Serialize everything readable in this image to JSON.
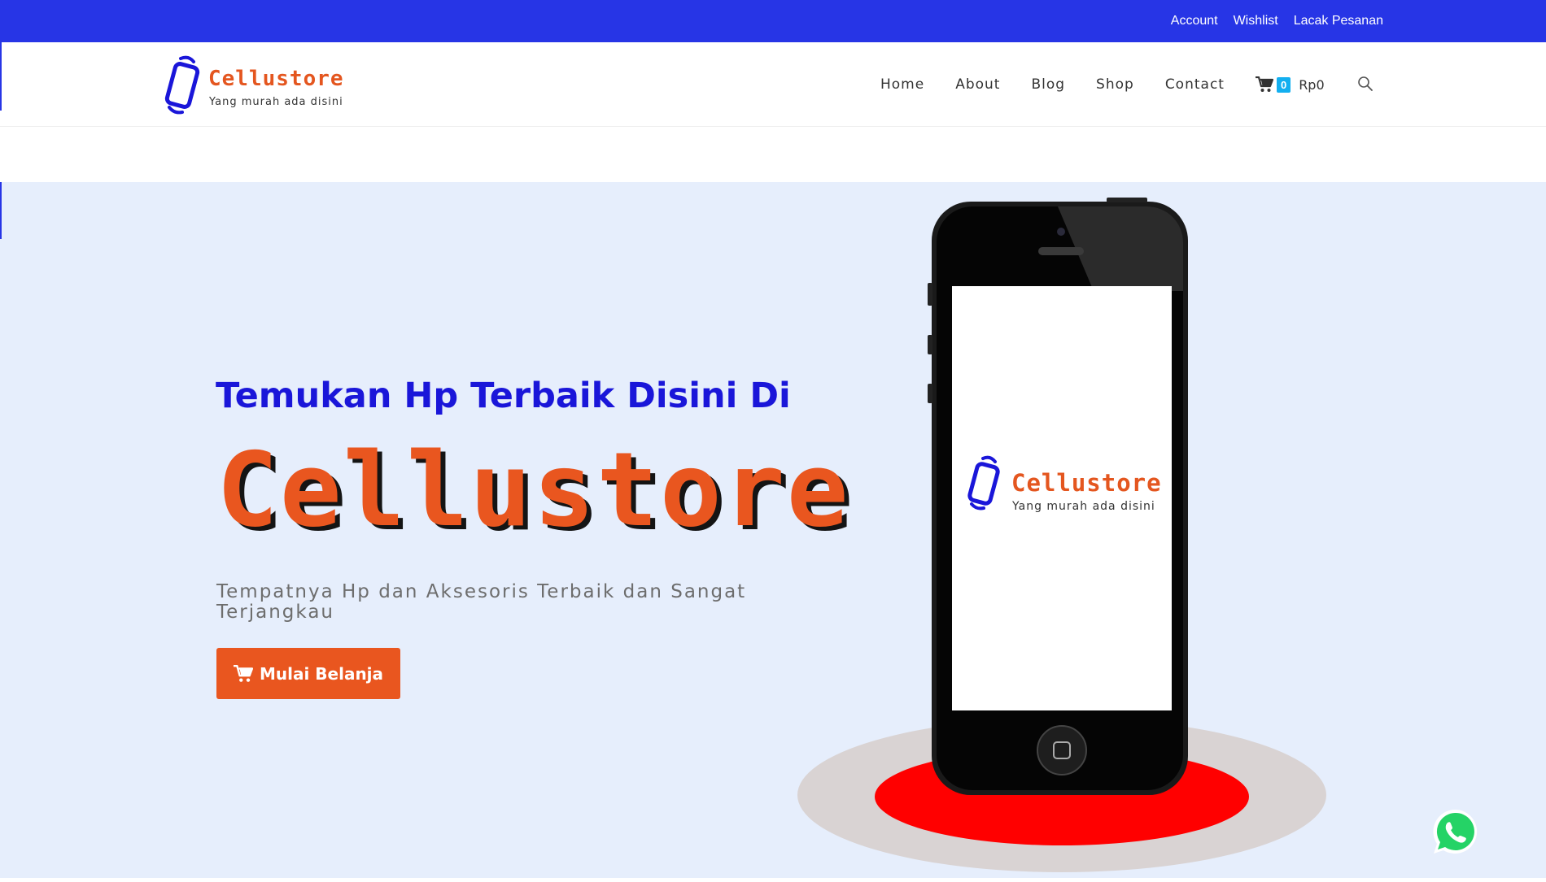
{
  "topbar": {
    "links": [
      "Account",
      "Wishlist",
      "Lacak Pesanan"
    ],
    "bg_color": "#2735e6"
  },
  "header": {
    "logo": {
      "name": "Cellustore",
      "tagline": "Yang murah ada disini",
      "icon": "phone-logo-icon"
    },
    "nav": [
      "Home",
      "About",
      "Blog",
      "Shop",
      "Contact"
    ],
    "cart": {
      "icon": "cart-icon",
      "count": "0",
      "total": "Rp0"
    },
    "search_icon": "search-icon"
  },
  "hero": {
    "subtitle": "Temukan Hp Terbaik Disini Di",
    "brand": "Cellustore",
    "description": "Tempatnya Hp dan Aksesoris Terbaik dan Sangat Terjangkau",
    "button_label": "Mulai Belanja",
    "button_icon": "cart-icon",
    "phone_screen_logo": {
      "name": "Cellustore",
      "tagline": "Yang murah ada disini"
    },
    "colors": {
      "background": "#e6eefc",
      "subtitle": "#1a16d9",
      "brand": "#e9561f",
      "button": "#e9561f"
    }
  },
  "floating": {
    "whatsapp_icon": "whatsapp-icon"
  }
}
